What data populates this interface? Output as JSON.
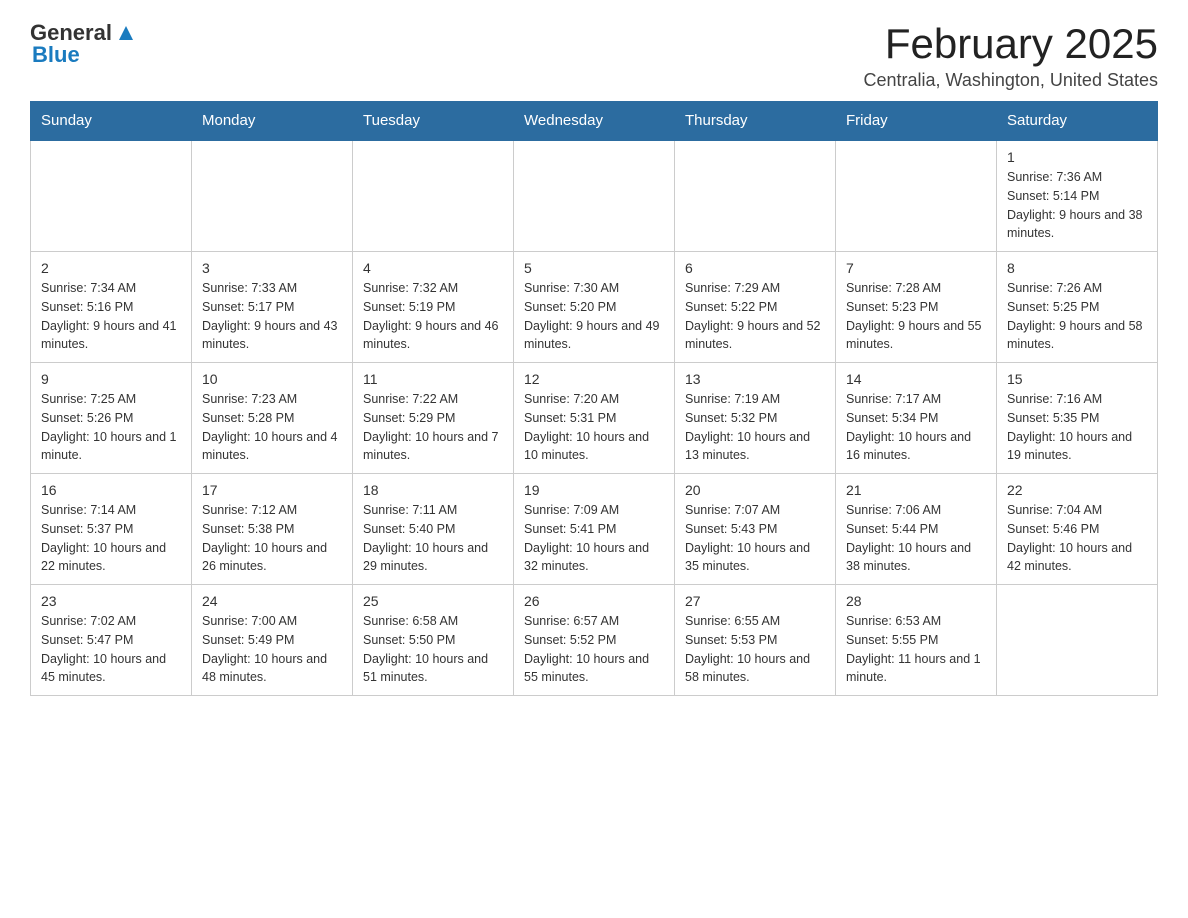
{
  "header": {
    "logo_general": "General",
    "logo_blue": "Blue",
    "month_title": "February 2025",
    "location": "Centralia, Washington, United States"
  },
  "columns": [
    "Sunday",
    "Monday",
    "Tuesday",
    "Wednesday",
    "Thursday",
    "Friday",
    "Saturday"
  ],
  "weeks": [
    [
      {
        "day": "",
        "info": ""
      },
      {
        "day": "",
        "info": ""
      },
      {
        "day": "",
        "info": ""
      },
      {
        "day": "",
        "info": ""
      },
      {
        "day": "",
        "info": ""
      },
      {
        "day": "",
        "info": ""
      },
      {
        "day": "1",
        "info": "Sunrise: 7:36 AM\nSunset: 5:14 PM\nDaylight: 9 hours and 38 minutes."
      }
    ],
    [
      {
        "day": "2",
        "info": "Sunrise: 7:34 AM\nSunset: 5:16 PM\nDaylight: 9 hours and 41 minutes."
      },
      {
        "day": "3",
        "info": "Sunrise: 7:33 AM\nSunset: 5:17 PM\nDaylight: 9 hours and 43 minutes."
      },
      {
        "day": "4",
        "info": "Sunrise: 7:32 AM\nSunset: 5:19 PM\nDaylight: 9 hours and 46 minutes."
      },
      {
        "day": "5",
        "info": "Sunrise: 7:30 AM\nSunset: 5:20 PM\nDaylight: 9 hours and 49 minutes."
      },
      {
        "day": "6",
        "info": "Sunrise: 7:29 AM\nSunset: 5:22 PM\nDaylight: 9 hours and 52 minutes."
      },
      {
        "day": "7",
        "info": "Sunrise: 7:28 AM\nSunset: 5:23 PM\nDaylight: 9 hours and 55 minutes."
      },
      {
        "day": "8",
        "info": "Sunrise: 7:26 AM\nSunset: 5:25 PM\nDaylight: 9 hours and 58 minutes."
      }
    ],
    [
      {
        "day": "9",
        "info": "Sunrise: 7:25 AM\nSunset: 5:26 PM\nDaylight: 10 hours and 1 minute."
      },
      {
        "day": "10",
        "info": "Sunrise: 7:23 AM\nSunset: 5:28 PM\nDaylight: 10 hours and 4 minutes."
      },
      {
        "day": "11",
        "info": "Sunrise: 7:22 AM\nSunset: 5:29 PM\nDaylight: 10 hours and 7 minutes."
      },
      {
        "day": "12",
        "info": "Sunrise: 7:20 AM\nSunset: 5:31 PM\nDaylight: 10 hours and 10 minutes."
      },
      {
        "day": "13",
        "info": "Sunrise: 7:19 AM\nSunset: 5:32 PM\nDaylight: 10 hours and 13 minutes."
      },
      {
        "day": "14",
        "info": "Sunrise: 7:17 AM\nSunset: 5:34 PM\nDaylight: 10 hours and 16 minutes."
      },
      {
        "day": "15",
        "info": "Sunrise: 7:16 AM\nSunset: 5:35 PM\nDaylight: 10 hours and 19 minutes."
      }
    ],
    [
      {
        "day": "16",
        "info": "Sunrise: 7:14 AM\nSunset: 5:37 PM\nDaylight: 10 hours and 22 minutes."
      },
      {
        "day": "17",
        "info": "Sunrise: 7:12 AM\nSunset: 5:38 PM\nDaylight: 10 hours and 26 minutes."
      },
      {
        "day": "18",
        "info": "Sunrise: 7:11 AM\nSunset: 5:40 PM\nDaylight: 10 hours and 29 minutes."
      },
      {
        "day": "19",
        "info": "Sunrise: 7:09 AM\nSunset: 5:41 PM\nDaylight: 10 hours and 32 minutes."
      },
      {
        "day": "20",
        "info": "Sunrise: 7:07 AM\nSunset: 5:43 PM\nDaylight: 10 hours and 35 minutes."
      },
      {
        "day": "21",
        "info": "Sunrise: 7:06 AM\nSunset: 5:44 PM\nDaylight: 10 hours and 38 minutes."
      },
      {
        "day": "22",
        "info": "Sunrise: 7:04 AM\nSunset: 5:46 PM\nDaylight: 10 hours and 42 minutes."
      }
    ],
    [
      {
        "day": "23",
        "info": "Sunrise: 7:02 AM\nSunset: 5:47 PM\nDaylight: 10 hours and 45 minutes."
      },
      {
        "day": "24",
        "info": "Sunrise: 7:00 AM\nSunset: 5:49 PM\nDaylight: 10 hours and 48 minutes."
      },
      {
        "day": "25",
        "info": "Sunrise: 6:58 AM\nSunset: 5:50 PM\nDaylight: 10 hours and 51 minutes."
      },
      {
        "day": "26",
        "info": "Sunrise: 6:57 AM\nSunset: 5:52 PM\nDaylight: 10 hours and 55 minutes."
      },
      {
        "day": "27",
        "info": "Sunrise: 6:55 AM\nSunset: 5:53 PM\nDaylight: 10 hours and 58 minutes."
      },
      {
        "day": "28",
        "info": "Sunrise: 6:53 AM\nSunset: 5:55 PM\nDaylight: 11 hours and 1 minute."
      },
      {
        "day": "",
        "info": ""
      }
    ]
  ]
}
